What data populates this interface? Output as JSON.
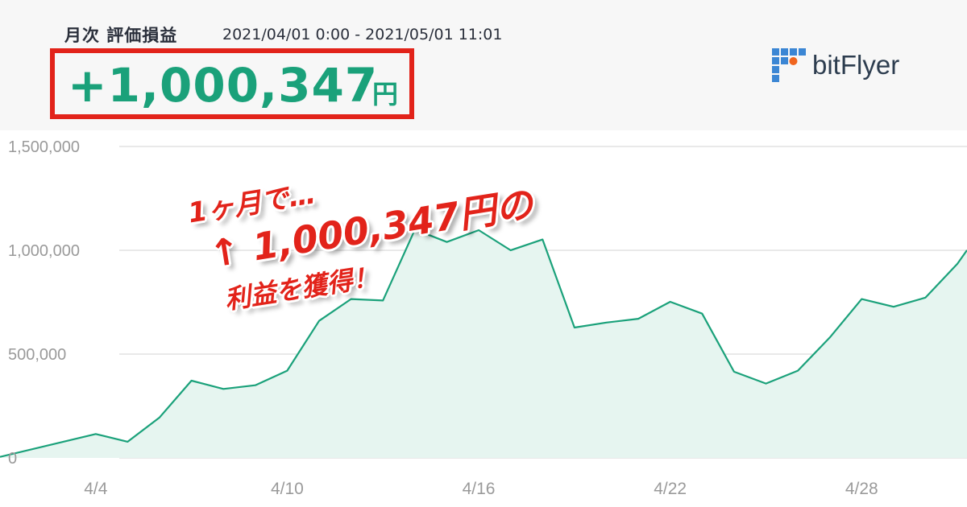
{
  "header": {
    "title": "月次 評価損益",
    "range": "2021/04/01 0:00 - 2021/05/01 11:01",
    "pnl_value": "+1,000,347",
    "pnl_unit": "円"
  },
  "brand": {
    "name": "bitFlyer",
    "accent_color": "#1aa17a",
    "highlight_color": "#e2231a"
  },
  "overlay": {
    "line1": "1ヶ月で…",
    "line2": "↑ 1,000,347円の",
    "line3": "利益を獲得！"
  },
  "chart_data": {
    "type": "area",
    "ylim": [
      0,
      1500000
    ],
    "ytick_values": [
      0,
      500000,
      1000000,
      1500000
    ],
    "ytick_labels": [
      "0",
      "500,000",
      "1,000,000",
      "1,500,000"
    ],
    "xlim": [
      1.0,
      31.3
    ],
    "xtick_values": [
      4,
      10,
      16,
      22,
      28
    ],
    "xtick_labels": [
      "4/4",
      "4/10",
      "4/16",
      "4/22",
      "4/28"
    ],
    "grid": true,
    "color": "#1aa17a",
    "fill_color": "#e6f5f0",
    "x": [
      1.0,
      4.0,
      5.0,
      6.0,
      7.0,
      8.0,
      9.0,
      10.0,
      11.0,
      12.0,
      13.0,
      14.0,
      15.0,
      16.0,
      17.0,
      18.0,
      19.0,
      20.0,
      21.0,
      22.0,
      23.0,
      24.0,
      25.0,
      26.0,
      27.0,
      28.0,
      29.0,
      30.0,
      31.0,
      31.3
    ],
    "values": [
      5000,
      115000,
      78000,
      195000,
      372000,
      332000,
      350000,
      420000,
      660000,
      765000,
      758000,
      1100000,
      1040000,
      1097000,
      1000000,
      1052000,
      628000,
      652000,
      670000,
      752000,
      695000,
      415000,
      358000,
      420000,
      580000,
      765000,
      728000,
      772000,
      935000,
      1000347
    ]
  }
}
